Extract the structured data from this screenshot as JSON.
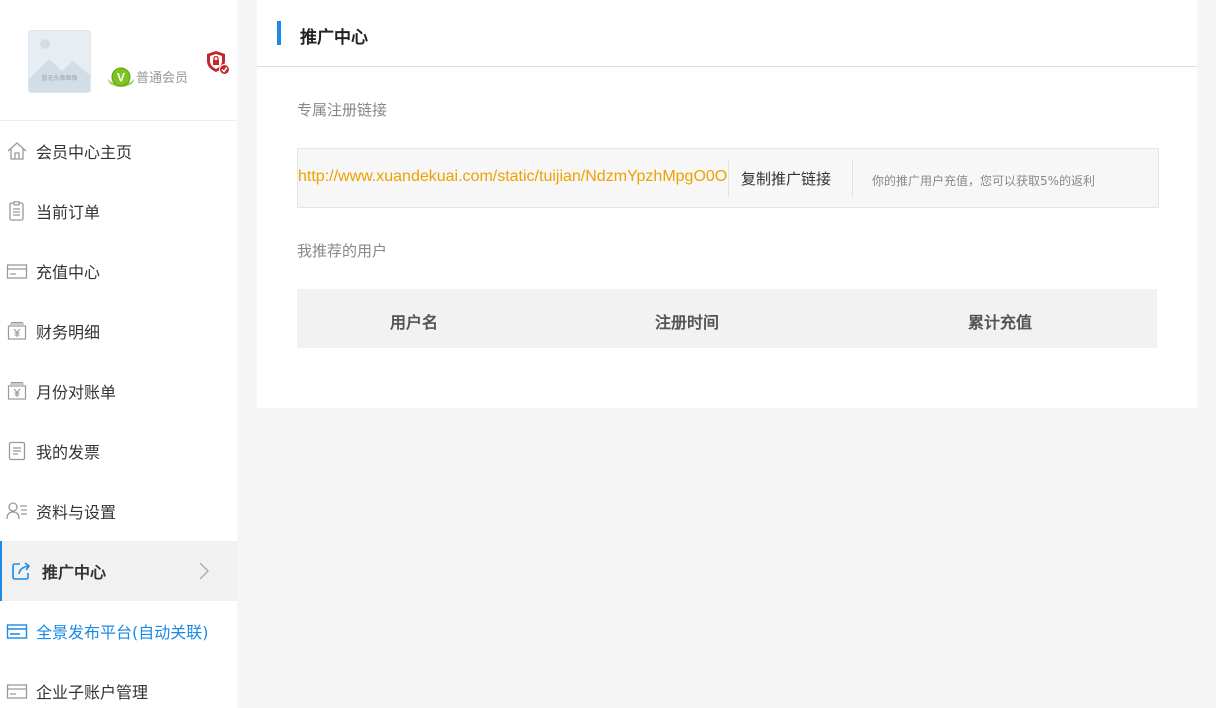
{
  "profile": {
    "avatar_caption": "暂无头像图像",
    "member_level": "普通会员",
    "vip_badge_letter": "V"
  },
  "sidebar": {
    "items": [
      {
        "label": "会员中心主页",
        "icon": "home-icon"
      },
      {
        "label": "当前订单",
        "icon": "clipboard-icon"
      },
      {
        "label": "充值中心",
        "icon": "card-icon"
      },
      {
        "label": "财务明细",
        "icon": "yen-bill-icon"
      },
      {
        "label": "月份对账单",
        "icon": "yen-bill-icon"
      },
      {
        "label": "我的发票",
        "icon": "document-icon"
      },
      {
        "label": "资料与设置",
        "icon": "user-settings-icon"
      },
      {
        "label": "推广中心",
        "icon": "share-icon",
        "active": true
      },
      {
        "label": "全景发布平台(自动关联)",
        "icon": "card-icon",
        "highlight": true
      },
      {
        "label": "企业子账户管理",
        "icon": "card-icon"
      }
    ]
  },
  "main": {
    "title": "推广中心",
    "register_link_label": "专属注册链接",
    "register_link": "http://www.xuandekuai.com/static/tuijian/NdzmYpzhMpgO0O",
    "copy_button_label": "复制推广链接",
    "rebate_note": "你的推广用户充值，您可以获取5%的返利",
    "my_referrals_label": "我推荐的用户",
    "table_headers": [
      "用户名",
      "注册时间",
      "累计充值"
    ]
  },
  "colors": {
    "accent": "#1a8ae6",
    "link": "#f0a000",
    "vip_green": "#7cc51f",
    "shield_red": "#c3272b"
  }
}
